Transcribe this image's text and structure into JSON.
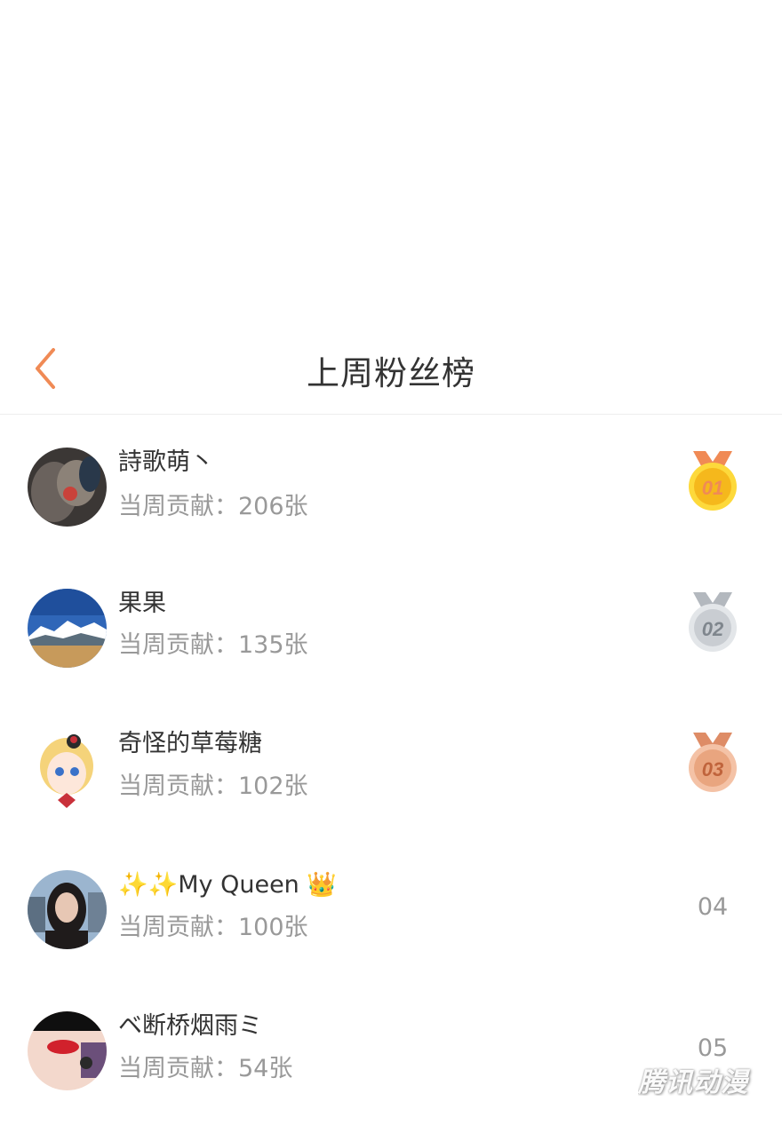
{
  "header": {
    "title": "上周粉丝榜",
    "back_icon": "chevron-left-icon",
    "accent_color": "#f08a55"
  },
  "fans": [
    {
      "rank": "01",
      "name": "詩歌萌丶",
      "contribution": "当周贡献：206张",
      "medal": "gold"
    },
    {
      "rank": "02",
      "name": "果果",
      "contribution": "当周贡献：135张",
      "medal": "silver"
    },
    {
      "rank": "03",
      "name": "奇怪的草莓糖",
      "contribution": "当周贡献：102张",
      "medal": "bronze"
    },
    {
      "rank": "04",
      "name": "✨✨My Queen 👑",
      "contribution": "当周贡献：100张",
      "medal": "none"
    },
    {
      "rank": "05",
      "name": "ベ断桥烟雨ミ",
      "contribution": "当周贡献：54张",
      "medal": "none"
    }
  ],
  "medal_colors": {
    "gold": "#f5b81c",
    "silver": "#c9cdd2",
    "bronze": "#e9a57f"
  },
  "watermark": "腾讯动漫"
}
